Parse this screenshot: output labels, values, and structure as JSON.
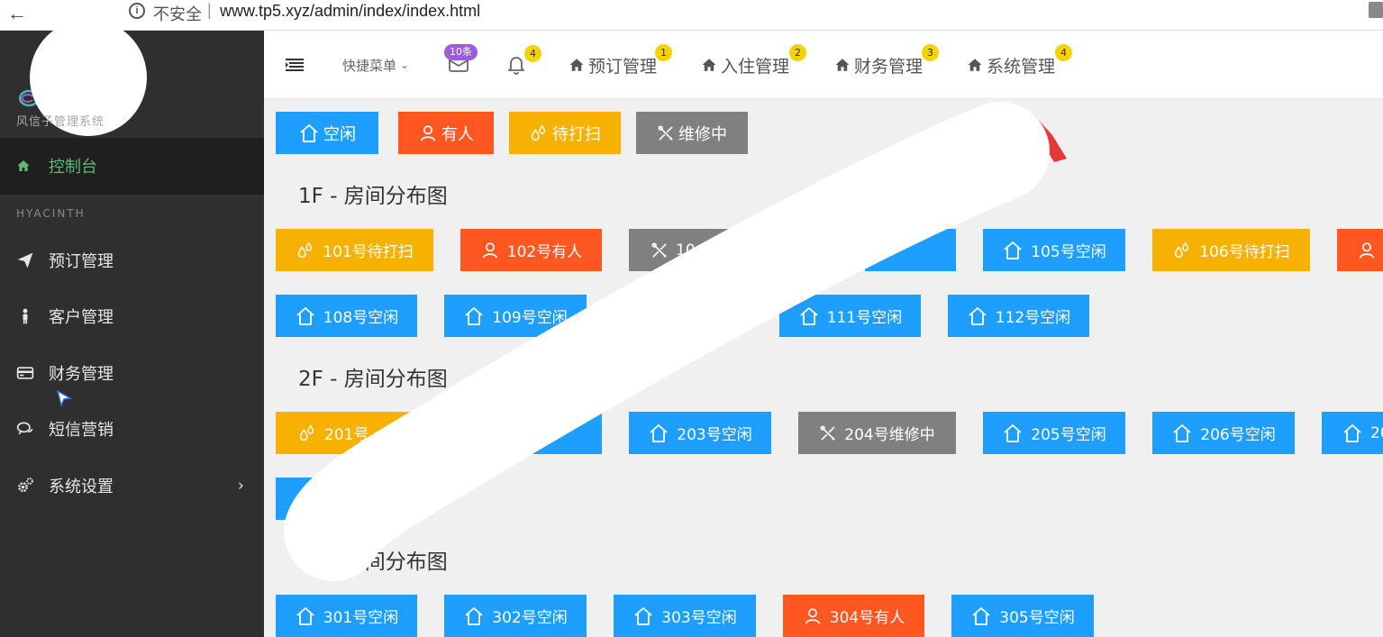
{
  "browser": {
    "insecure_label": "不安全",
    "separator": "|",
    "url": "www.tp5.xyz/admin/index/index.html"
  },
  "sidebar": {
    "brand_name": "风信子管理系统",
    "dashboard": "控制台",
    "section_title": "HYACINTH",
    "items": [
      {
        "label": "预订管理",
        "icon": "paper-plane-icon"
      },
      {
        "label": "客户管理",
        "icon": "person-icon"
      },
      {
        "label": "财务管理",
        "icon": "credit-card-icon"
      },
      {
        "label": "短信营销",
        "icon": "chat-icon"
      },
      {
        "label": "系统设置",
        "icon": "gears-icon"
      }
    ]
  },
  "header": {
    "quick_menu": "快捷菜单",
    "mail_badge": "10条",
    "bell_badge": "4",
    "nav": [
      {
        "label": "预订管理",
        "badge": "1"
      },
      {
        "label": "入住管理",
        "badge": "2"
      },
      {
        "label": "财务管理",
        "badge": "3"
      },
      {
        "label": "系统管理",
        "badge": "4"
      }
    ]
  },
  "legend": [
    {
      "label": "空闲",
      "status": "free"
    },
    {
      "label": "有人",
      "status": "busy"
    },
    {
      "label": "待打扫",
      "status": "clean"
    },
    {
      "label": "维修中",
      "status": "fix"
    }
  ],
  "colors": {
    "free": "#1e9fff",
    "busy": "#ff5722",
    "clean": "#f7b100",
    "fix": "#808080",
    "sidebar": "#2f2f2f",
    "active_text": "#5fb878"
  },
  "floors": [
    {
      "title": "1F - 房间分布图",
      "rooms": [
        {
          "label": "101号待打扫",
          "status": "clean"
        },
        {
          "label": "102号有人",
          "status": "busy"
        },
        {
          "label": "10",
          "status": "fix"
        },
        {
          "label": "105号空闲",
          "status": "free"
        },
        {
          "label": "106号待打扫",
          "status": "clean"
        },
        {
          "label": "",
          "status": "busy"
        },
        {
          "label": "108号空闲",
          "status": "free"
        },
        {
          "label": "109号空闲",
          "status": "free"
        },
        {
          "label": "111号空闲",
          "status": "free"
        },
        {
          "label": "112号空闲",
          "status": "free"
        }
      ]
    },
    {
      "title": "2F - 房间分布图",
      "rooms": [
        {
          "label": "201号",
          "status": "clean"
        },
        {
          "label": "203号空闲",
          "status": "free"
        },
        {
          "label": "204号维修中",
          "status": "fix"
        },
        {
          "label": "205号空闲",
          "status": "free"
        },
        {
          "label": "206号空闲",
          "status": "free"
        },
        {
          "label": "20",
          "status": "free"
        }
      ]
    },
    {
      "title": "3F - 房间分布图",
      "rooms": [
        {
          "label": "301号空闲",
          "status": "free"
        },
        {
          "label": "302号空闲",
          "status": "free"
        },
        {
          "label": "303号空闲",
          "status": "free"
        },
        {
          "label": "304号有人",
          "status": "busy"
        },
        {
          "label": "305号空闲",
          "status": "free"
        }
      ]
    }
  ]
}
